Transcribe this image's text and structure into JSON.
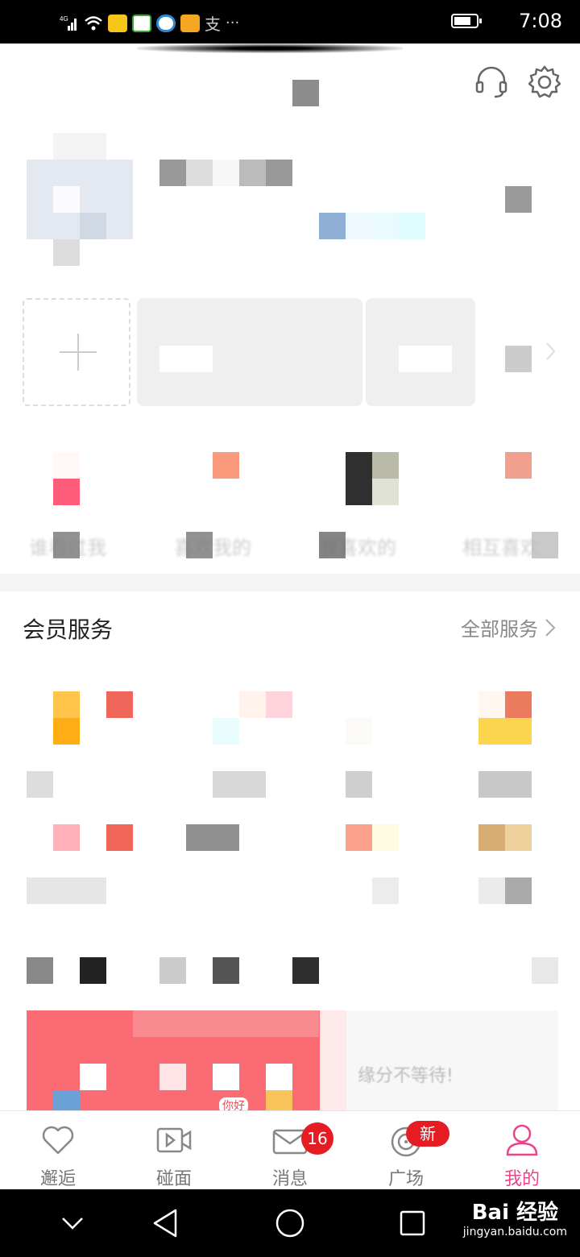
{
  "status_bar": {
    "network": "4G",
    "time": "7:08",
    "battery_level": 0.65,
    "notification_icons": [
      "signal-icon",
      "wifi-icon",
      "folder-app-icon",
      "video-app-icon",
      "browser-app-icon",
      "weibo-app-icon",
      "alipay-icon",
      "more-icon"
    ],
    "alipay_glyph": "支",
    "more_glyph": "···"
  },
  "header": {
    "icons": [
      "headset-icon",
      "settings-icon"
    ]
  },
  "profile": {
    "blurred_texts": [
      "谁看过我",
      "喜欢我的",
      "我喜欢的",
      "相互喜欢"
    ]
  },
  "member_services": {
    "title": "会员服务",
    "all_label": "全部服务"
  },
  "banner": {
    "tag": "你好",
    "text": "缘分不等待!"
  },
  "tabbar": {
    "tabs": [
      {
        "label": "邂逅",
        "icon": "heart-icon",
        "active": false
      },
      {
        "label": "碰面",
        "icon": "video-icon",
        "active": false
      },
      {
        "label": "消息",
        "icon": "mail-icon",
        "badge": "16",
        "active": false
      },
      {
        "label": "广场",
        "icon": "target-icon",
        "badge": "新",
        "active": false
      },
      {
        "label": "我的",
        "icon": "user-icon",
        "active": true
      }
    ]
  },
  "watermark": {
    "brand": "Bai 经验",
    "url": "jingyan.baidu.com"
  },
  "colors": {
    "accent": "#e8458b",
    "badge": "#e51c23"
  }
}
